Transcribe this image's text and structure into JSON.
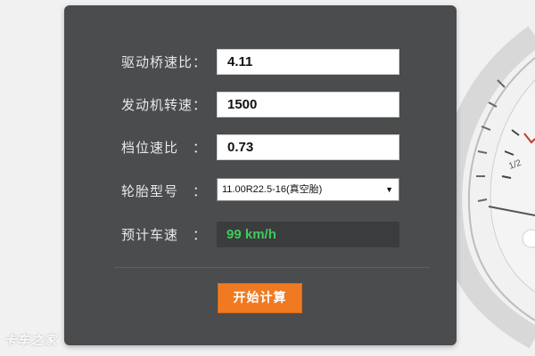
{
  "form": {
    "rows": [
      {
        "label": "驱动桥速比",
        "colon": "：",
        "value": "4.11"
      },
      {
        "label": "发动机转速",
        "colon": "：",
        "value": "1500"
      },
      {
        "label": "档位速比",
        "colon": "：",
        "value": "0.73"
      },
      {
        "label": "轮胎型号",
        "colon": "：",
        "selected": "11.00R22.5-16(真空胎)"
      },
      {
        "label": "预计车速",
        "colon": "：",
        "result": "99 km/h"
      }
    ],
    "submit_label": "开始计算"
  },
  "gauge_marks": {
    "half": "1/2"
  },
  "watermark": "卡车之家",
  "colors": {
    "panel": "#4a4c4e",
    "accent": "#ef7a22",
    "result_text": "#3ecb5a"
  }
}
